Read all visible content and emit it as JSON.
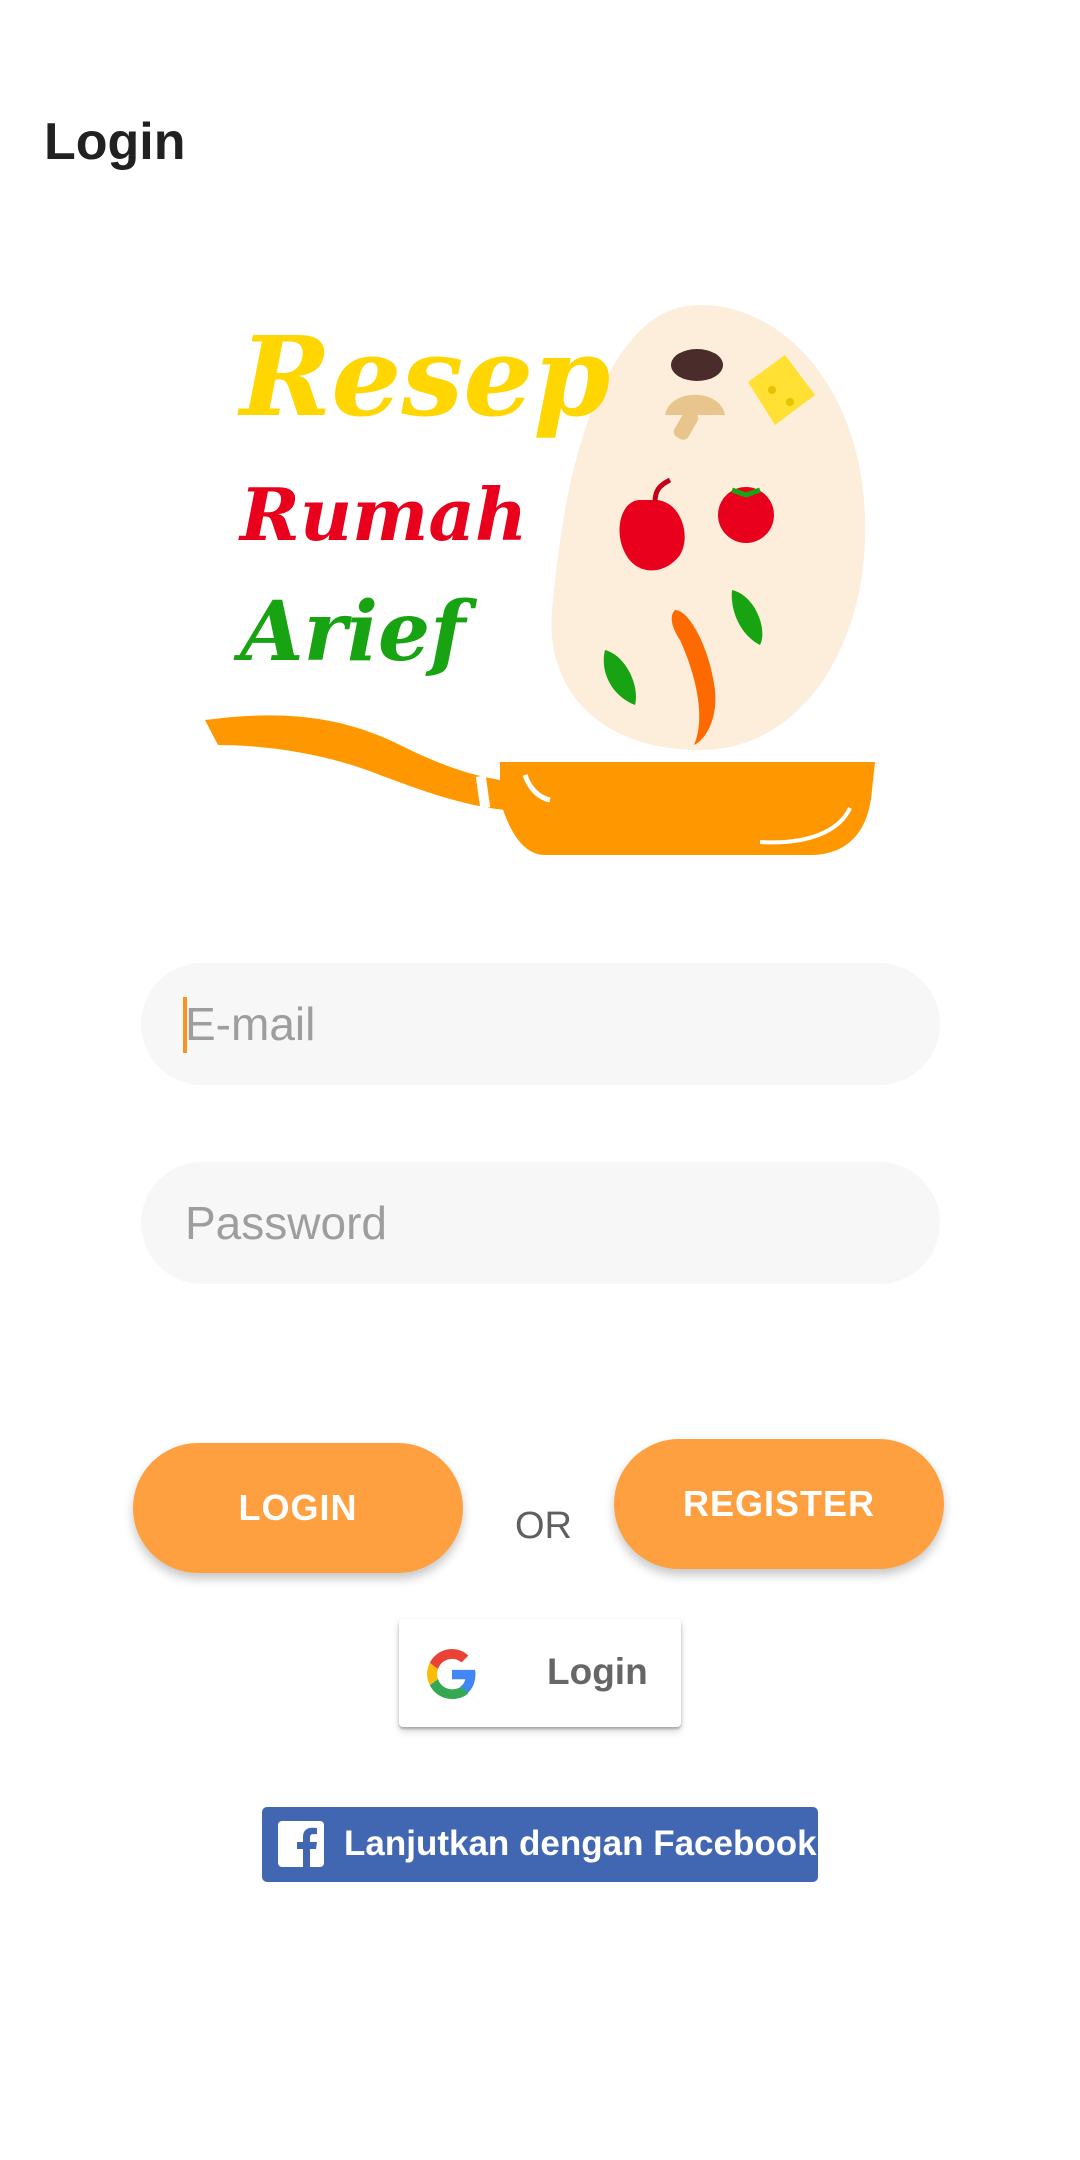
{
  "appbar": {
    "title": "Login"
  },
  "logo": {
    "line1": "Resep",
    "line2": "Rumah",
    "line3": "Arief",
    "colors": {
      "line1": "#ffd600",
      "line2": "#e8001c",
      "line3": "#17a312",
      "pan": "#ff9800",
      "blob": "#fdeedb"
    }
  },
  "form": {
    "email_placeholder": "E-mail",
    "email_value": "",
    "password_placeholder": "Password",
    "password_value": ""
  },
  "buttons": {
    "login_label": "LOGIN",
    "or_label": "OR",
    "register_label": "REGISTER",
    "google_label": "Login",
    "facebook_label": "Lanjutkan dengan Facebook"
  },
  "icons": {
    "google": "google-g-icon",
    "facebook": "facebook-f-icon"
  },
  "colors": {
    "accent": "#ffa040",
    "facebook": "#4267b2",
    "title": "#212121"
  }
}
